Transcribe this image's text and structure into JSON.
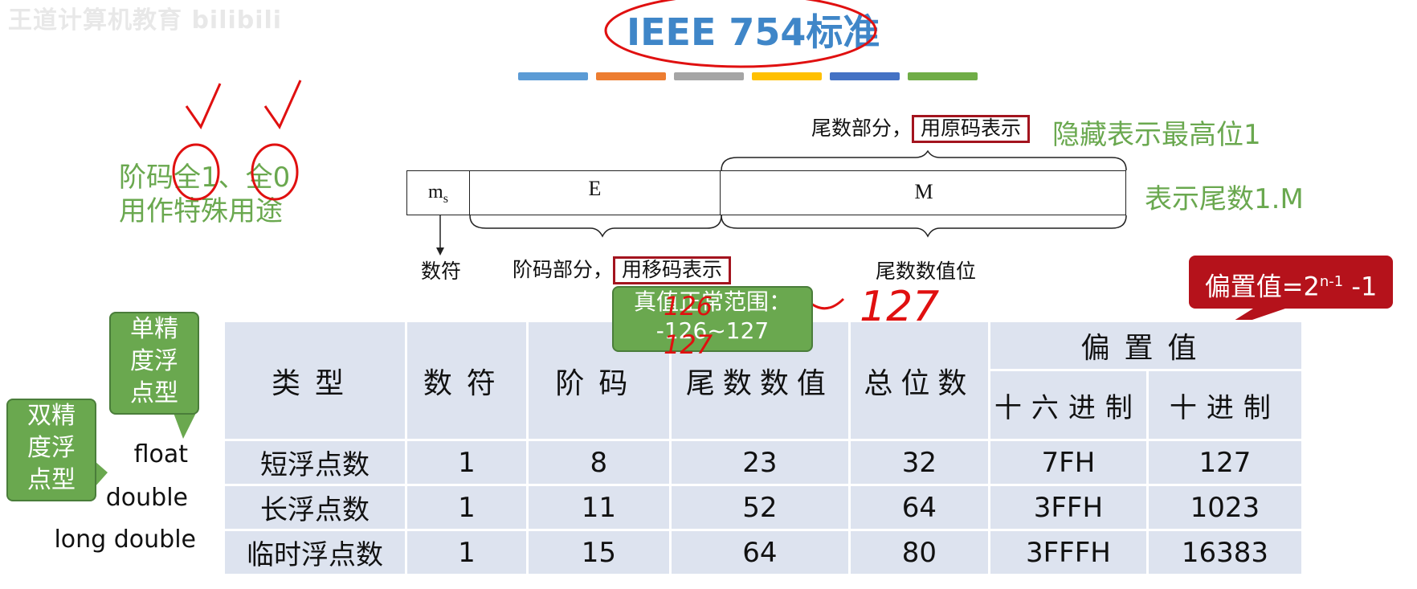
{
  "watermark": "王道计算机教育 bilibili",
  "title": "IEEE 754标准",
  "color_bars": [
    "#5b9bd5",
    "#ed7d31",
    "#a5a5a5",
    "#ffc000",
    "#4472c4",
    "#70ad47"
  ],
  "left_note": {
    "line1_a": "阶码",
    "line1_b": "全1",
    "line1_c": "、",
    "line1_d": "全0",
    "line2": "用作特殊用途"
  },
  "mantissa_top": {
    "prefix": "尾数部分，",
    "boxed": "用原码表示",
    "note": "隐藏表示最高位1"
  },
  "fields": {
    "ms": "m",
    "ms_sub": "s",
    "e": "E",
    "m": "M"
  },
  "right_note": "表示尾数1.M",
  "bottom_labels": {
    "sign": "数符",
    "exp_prefix": "阶码部分，",
    "exp_boxed": "用移码表示",
    "mantissa": "尾数数值位"
  },
  "bias_callout": {
    "text": "偏置值=2",
    "sup": "n-1",
    "suffix": " -1"
  },
  "exp_range_callout": {
    "line1": "真值正常范围：",
    "line2": "-126~127"
  },
  "single_callout": {
    "l1": "单精",
    "l2": "度浮",
    "l3": "点型"
  },
  "double_callout": {
    "l1": "双精",
    "l2": "度浮",
    "l3": "点型"
  },
  "handwriting": {
    "n126": "126",
    "n127a": "127",
    "n127b": "127"
  },
  "table": {
    "headers": {
      "type": "类型",
      "sign": "数符",
      "exp": "阶码",
      "mant": "尾数数值",
      "total": "总位数",
      "bias": "偏置值",
      "hex": "十六进制",
      "dec": "十进制"
    },
    "row_labels": [
      "float",
      "double",
      "long double"
    ],
    "rows": [
      {
        "type": "短浮点数",
        "sign": "1",
        "exp": "8",
        "mant": "23",
        "total": "32",
        "hex": "7FH",
        "dec": "127"
      },
      {
        "type": "长浮点数",
        "sign": "1",
        "exp": "11",
        "mant": "52",
        "total": "64",
        "hex": "3FFH",
        "dec": "1023"
      },
      {
        "type": "临时浮点数",
        "sign": "1",
        "exp": "15",
        "mant": "64",
        "total": "80",
        "hex": "3FFFH",
        "dec": "16383"
      }
    ]
  }
}
